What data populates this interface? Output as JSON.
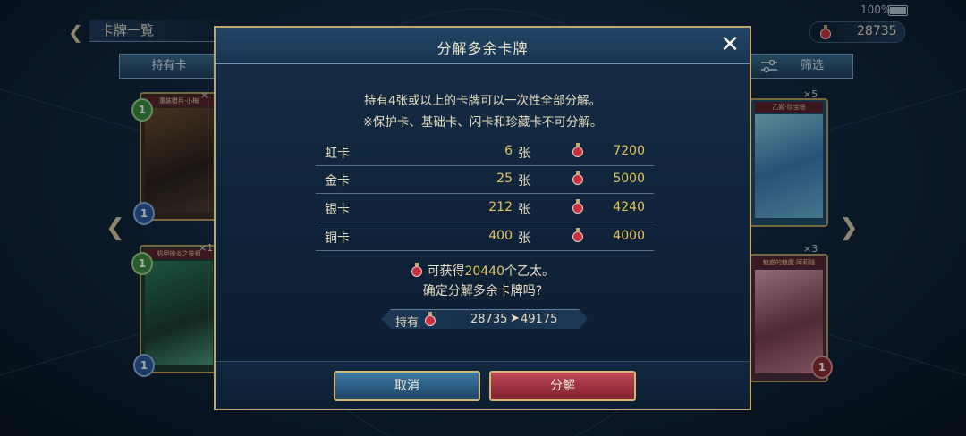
{
  "status": {
    "battery": "100%"
  },
  "header": {
    "title": "卡牌一覧",
    "currency_value": "28735"
  },
  "tabs": {
    "owned": "持有卡",
    "filter": "筛选"
  },
  "cards": [
    {
      "ribbon": "重装猎兵·小梅",
      "cost": "1",
      "badge": "1",
      "count": "×"
    },
    {
      "ribbon": "乙姬·珍宝塔",
      "count": "×5"
    },
    {
      "ribbon": "机甲操炎之技师",
      "cost": "1",
      "badge": "1",
      "count": "×1"
    },
    {
      "ribbon": "魅惑的魅魔·阿莉娅",
      "badge": "1",
      "count": "×3"
    }
  ],
  "dialog": {
    "title": "分解多余卡牌",
    "desc_line1": "持有4张或以上的卡牌可以一次性全部分解。",
    "desc_line2": "※保护卡、基础卡、闪卡和珍藏卡不可分解。",
    "rows": [
      {
        "name": "虹卡",
        "qty": "6",
        "unit": "张",
        "amount": "7200"
      },
      {
        "name": "金卡",
        "qty": "25",
        "unit": "张",
        "amount": "5000"
      },
      {
        "name": "银卡",
        "qty": "212",
        "unit": "张",
        "amount": "4240"
      },
      {
        "name": "铜卡",
        "qty": "400",
        "unit": "张",
        "amount": "4000"
      }
    ],
    "gain_prefix": "可获得",
    "gain_value": "20440",
    "gain_suffix": "个乙太。",
    "confirm": "确定分解多余卡牌吗?",
    "hold_label": "持有",
    "hold_from": "28735",
    "hold_to": "49175",
    "cancel_label": "取消",
    "ok_label": "分解"
  },
  "colors": {
    "gold_text": "#e4c35c",
    "border_gold": "#c2a86c",
    "ok_button": "#a8323f",
    "cancel_button": "#2d6490"
  },
  "icons": [
    "back-arrow-icon",
    "potion-icon",
    "close-icon",
    "filter-icon",
    "nav-left-icon",
    "nav-right-icon"
  ]
}
